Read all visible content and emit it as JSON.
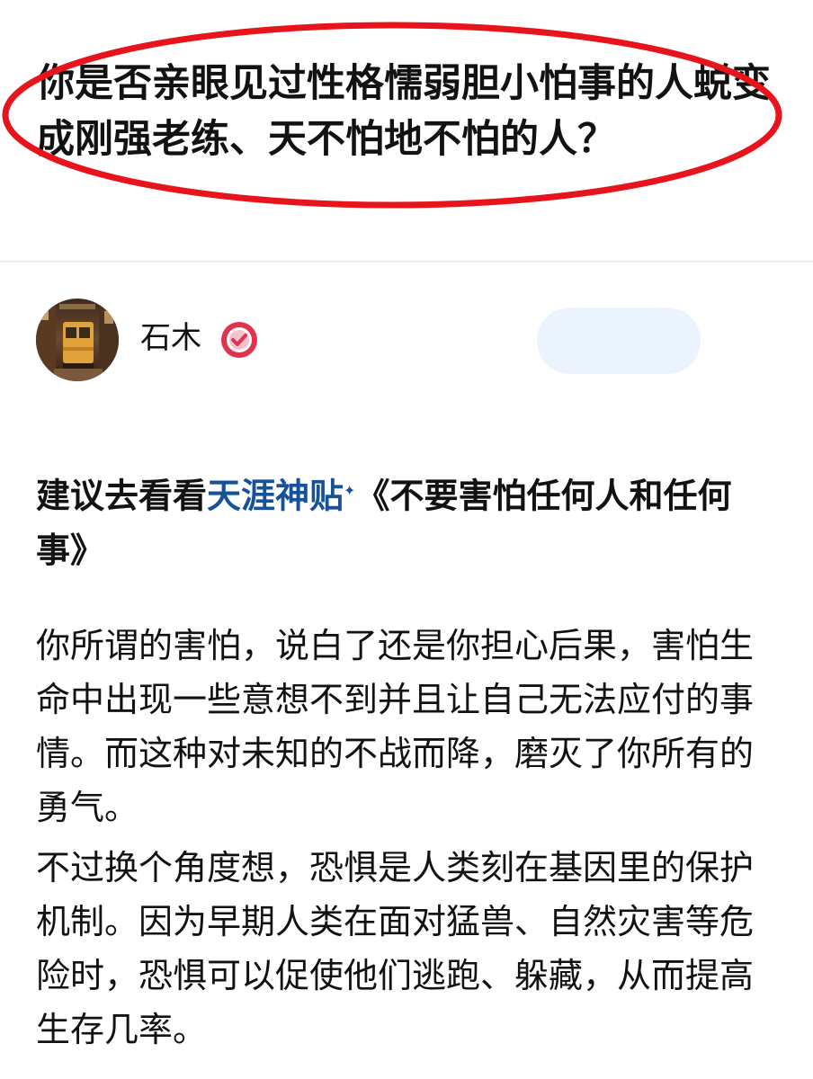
{
  "question": {
    "title": "你是否亲眼见过性格懦弱胆小怕事的人蜕变成刚强老练、天不怕地不怕的人？"
  },
  "author": {
    "name": "石木",
    "follow_label": ""
  },
  "answer": {
    "heading_prefix": "建议去看看",
    "heading_link": "天涯神贴",
    "heading_sparkle": "✦",
    "heading_suffix": "《不要害怕任何人和任何事》",
    "paragraphs": [
      "你所谓的害怕，说白了还是你担心后果，害怕生命中出现一些意想不到并且让自己无法应付的事情。而这种对未知的不战而降，磨灭了你所有的勇气。",
      "不过换个角度想，恐惧是人类刻在基因里的保护机制。因为早期人类在面对猛兽、自然灾害等危险时，恐惧可以促使他们逃跑、躲藏，从而提高生存几率。"
    ]
  },
  "colors": {
    "ellipse": "#e8141c",
    "link": "#175199",
    "follow_bg": "#ebf3ff",
    "verified_red": "#e0334f"
  }
}
